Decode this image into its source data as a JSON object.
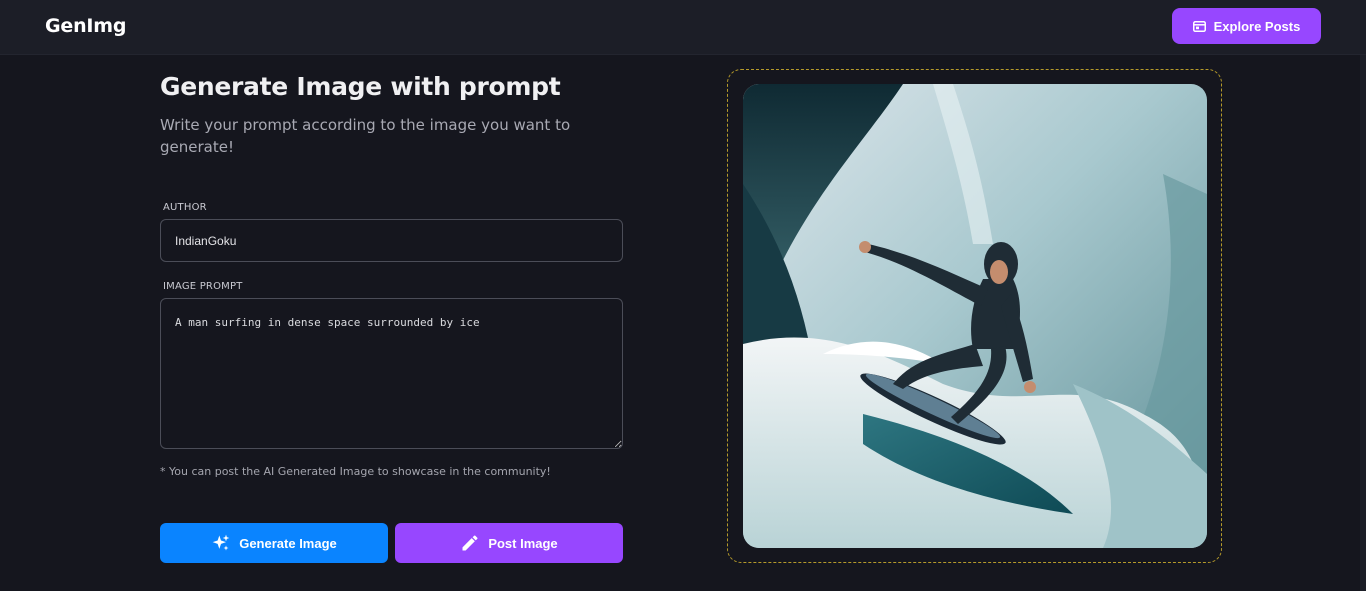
{
  "header": {
    "logo": "GenImg",
    "explore_button": "Explore Posts"
  },
  "form": {
    "title": "Generate Image with prompt",
    "subtitle": "Write your prompt according to the image you want to generate!",
    "author_label": "AUTHOR",
    "author_value": "IndianGoku",
    "prompt_label": "IMAGE PROMPT",
    "prompt_value": "A man surfing in dense space surrounded by ice",
    "note": "* You can post the AI Generated Image to showcase in the community!",
    "generate_button": "Generate Image",
    "post_button": "Post Image"
  },
  "preview": {
    "image_icon": "generated-image-surfer",
    "border_color": "#b59a2a"
  },
  "colors": {
    "generate": "#0a84ff",
    "accent": "#9747ff",
    "background": "#15161e"
  }
}
